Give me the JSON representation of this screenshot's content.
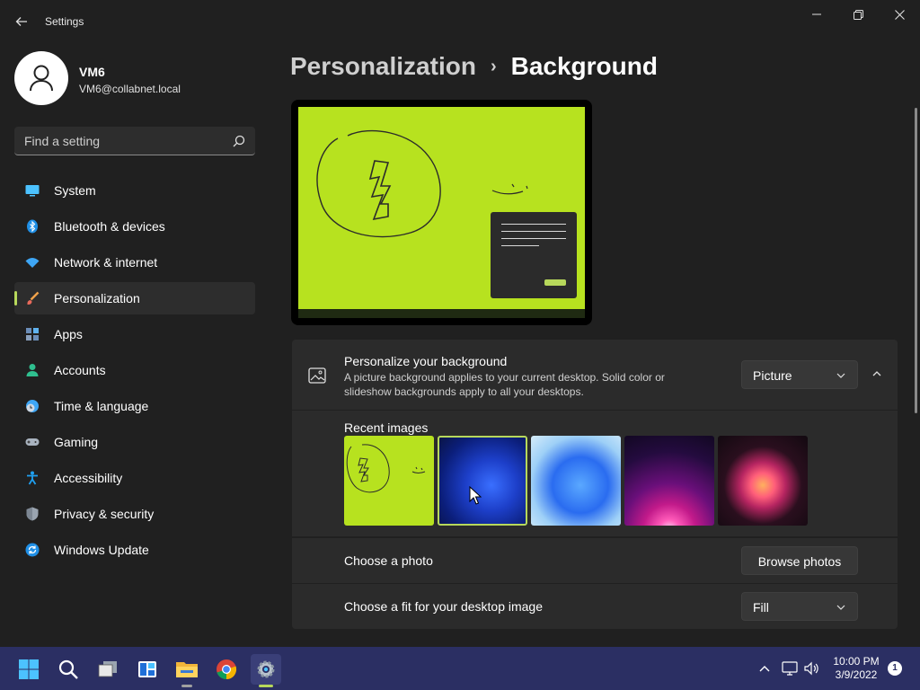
{
  "window": {
    "app_title": "Settings",
    "back_icon": "back-arrow-icon",
    "controls": [
      "minimize-icon",
      "restore-icon",
      "close-icon"
    ]
  },
  "account": {
    "name": "VM6",
    "email": "VM6@collabnet.local",
    "avatar_icon": "user-icon"
  },
  "search": {
    "placeholder": "Find a setting",
    "icon": "search-icon"
  },
  "sidebar": {
    "items": [
      {
        "label": "System",
        "icon": "system-icon",
        "active": false
      },
      {
        "label": "Bluetooth & devices",
        "icon": "bluetooth-icon",
        "active": false
      },
      {
        "label": "Network & internet",
        "icon": "wifi-icon",
        "active": false
      },
      {
        "label": "Personalization",
        "icon": "brush-icon",
        "active": true
      },
      {
        "label": "Apps",
        "icon": "apps-icon",
        "active": false
      },
      {
        "label": "Accounts",
        "icon": "accounts-icon",
        "active": false
      },
      {
        "label": "Time & language",
        "icon": "clock-globe-icon",
        "active": false
      },
      {
        "label": "Gaming",
        "icon": "gamepad-icon",
        "active": false
      },
      {
        "label": "Accessibility",
        "icon": "accessibility-icon",
        "active": false
      },
      {
        "label": "Privacy & security",
        "icon": "shield-icon",
        "active": false
      },
      {
        "label": "Windows Update",
        "icon": "update-icon",
        "active": false
      }
    ]
  },
  "breadcrumb": {
    "parent": "Personalization",
    "separator": "›",
    "current": "Background"
  },
  "background_card": {
    "icon": "picture-icon",
    "title": "Personalize your background",
    "description": "A picture background applies to your current desktop. Solid color or slideshow backgrounds apply to all your desktops.",
    "dropdown_value": "Picture",
    "collapse_icon": "chevron-up-icon"
  },
  "recent_images": {
    "label": "Recent images",
    "items": [
      {
        "name": "lime-sketch",
        "selected": false
      },
      {
        "name": "dark-blue-bloom",
        "selected": true
      },
      {
        "name": "light-blue-bloom",
        "selected": false
      },
      {
        "name": "purple-glow",
        "selected": false
      },
      {
        "name": "colorful-flower",
        "selected": false
      }
    ]
  },
  "choose_photo": {
    "label": "Choose a photo",
    "button": "Browse photos"
  },
  "choose_fit": {
    "label": "Choose a fit for your desktop image",
    "dropdown_value": "Fill"
  },
  "taskbar": {
    "apps": [
      "start-icon",
      "search-icon",
      "task-view-icon",
      "widgets-icon",
      "file-explorer-icon",
      "chrome-icon",
      "settings-icon"
    ],
    "tray_icons": [
      "chevron-up-icon",
      "network-icon",
      "volume-icon"
    ],
    "time": "10:00 PM",
    "date": "3/9/2022",
    "notification_count": "1"
  },
  "colors": {
    "accent": "#b7d85b",
    "wallpaper": "#b7e21f",
    "background": "#202020",
    "card": "#2b2b2b",
    "taskbar": "#2b2f63"
  }
}
